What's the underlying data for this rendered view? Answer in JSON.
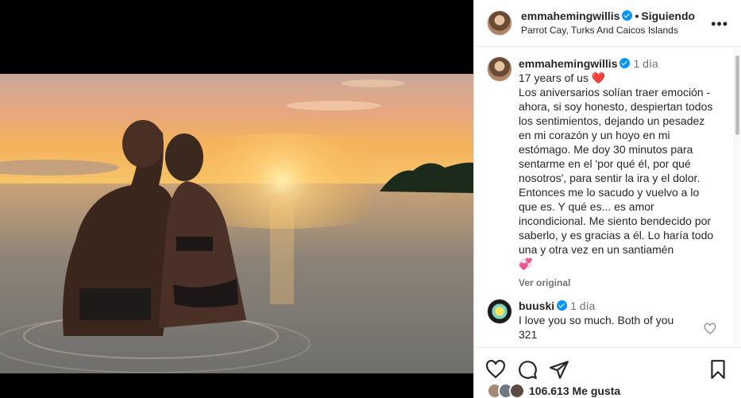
{
  "post": {
    "username": "emmahemingwillis",
    "separator": "•",
    "follow_status": "Siguiendo",
    "location": "Parrot Cay, Turks And Caicos Islands",
    "more_icon": "more-icon"
  },
  "caption": {
    "username": "emmahemingwillis",
    "time": "1 día",
    "first_line": "17 years of us",
    "heart": "❤️",
    "text": "Los aniversarios solían traer emoción - ahora, si soy honesto, despiertan todos los sentimientos, dejando un pesadez en mi corazón y un hoyo en mi estómago. Me doy 30 minutos para sentarme en el 'por qué él, por qué nosotros', para sentir la ira y el dolor. Entonces me lo sacudo y vuelvo a lo que es. Y qué es... es amor incondicional. Me siento bendecido por saberlo, y es gracias a él. Lo haría todo una y otra vez en un santiamén",
    "end_emoji": "💞",
    "see_original": "Ver original"
  },
  "comments": [
    {
      "username": "buuski",
      "time": "1 día",
      "text": "I love you so much. Both of you 321"
    }
  ],
  "actions": {
    "icons": [
      "heart-icon",
      "comment-icon",
      "share-icon",
      "bookmark-icon"
    ]
  },
  "likes": {
    "count_label": "106.613 Me gusta"
  },
  "colors": {
    "verified": "#0095f6",
    "text": "#262626",
    "secondary": "#737373"
  }
}
